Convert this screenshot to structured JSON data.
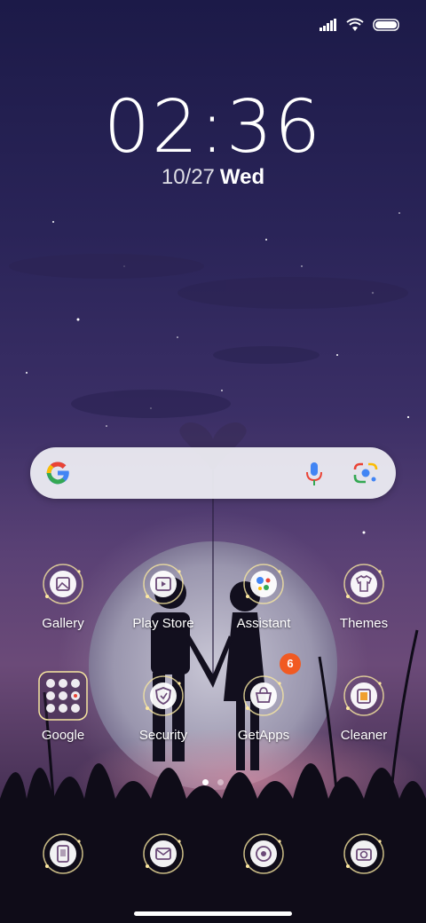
{
  "status_bar": {
    "icons": [
      "signal-icon",
      "wifi-icon",
      "battery-icon"
    ]
  },
  "lock": {
    "time": "02:36",
    "date": "10/27",
    "weekday": "Wed"
  },
  "search_bar": {
    "icons": [
      "google-g-icon",
      "microphone-icon",
      "google-lens-icon"
    ]
  },
  "apps": [
    {
      "label": "Gallery",
      "icon": "gallery-icon"
    },
    {
      "label": "Play Store",
      "icon": "play-store-icon"
    },
    {
      "label": "Assistant",
      "icon": "assistant-icon"
    },
    {
      "label": "Themes",
      "icon": "themes-icon"
    },
    {
      "label": "Google",
      "icon": "google-folder-icon"
    },
    {
      "label": "Security",
      "icon": "security-icon"
    },
    {
      "label": "GetApps",
      "icon": "getapps-icon",
      "badge": "6"
    },
    {
      "label": "Cleaner",
      "icon": "cleaner-icon"
    }
  ],
  "page_indicator": {
    "pages": 2,
    "current": 1
  },
  "dock": [
    {
      "icon": "phone-icon"
    },
    {
      "icon": "messages-icon"
    },
    {
      "icon": "browser-icon"
    },
    {
      "icon": "camera-icon"
    }
  ],
  "colors": {
    "badge": "#f15a22",
    "icon_glow": "#f6e6a0"
  }
}
